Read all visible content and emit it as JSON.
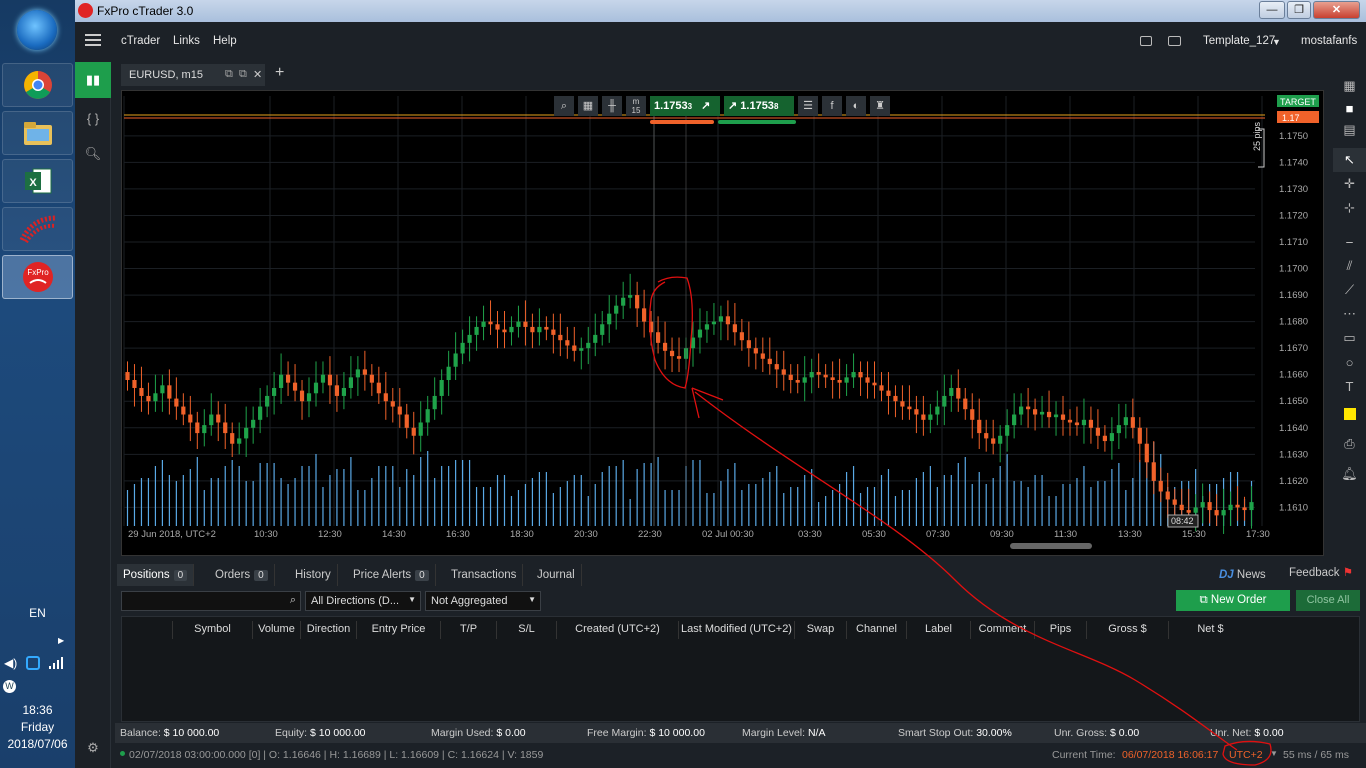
{
  "taskbar": {
    "lang": "EN",
    "time": "18:36",
    "day": "Friday",
    "date": "2018/07/06"
  },
  "window": {
    "title": "FxPro cTrader 3.0"
  },
  "menu": {
    "items": [
      "cTrader",
      "Links",
      "Help"
    ],
    "template": "Template_127",
    "user": "mostafanfs"
  },
  "tab": {
    "label": "EURUSD, m15"
  },
  "chart_toolbar": {
    "timeframe": "m",
    "timeframe_sub": "15",
    "sell_price": "1.1753",
    "sell_sup": "3",
    "buy_price": "1.1753",
    "buy_sup": "8"
  },
  "chart_data": {
    "type": "candlestick",
    "yticks": [
      "1.1750",
      "1.1740",
      "1.1730",
      "1.1720",
      "1.1710",
      "1.1700",
      "1.1690",
      "1.1680",
      "1.1670",
      "1.1660",
      "1.1650",
      "1.1640",
      "1.1630",
      "1.1620",
      "1.1610"
    ],
    "ylim": [
      1.1603,
      1.1765
    ],
    "xticks": [
      "29 Jun 2018, UTC+2",
      "10:30",
      "12:30",
      "14:30",
      "16:30",
      "18:30",
      "20:30",
      "22:30",
      "02 Jul 00:30",
      "03:30",
      "05:30",
      "07:30",
      "09:30",
      "11:30",
      "13:30",
      "15:30",
      "17:30"
    ],
    "target_label": "TARGET",
    "price_label": "1.17",
    "pips_label": "25 pips",
    "cursor_time": "08:42",
    "close": [
      1.1658,
      1.1655,
      1.1652,
      1.165,
      1.1653,
      1.1656,
      1.1651,
      1.1648,
      1.1645,
      1.1642,
      1.1638,
      1.1641,
      1.1645,
      1.1642,
      1.1638,
      1.1634,
      1.1636,
      1.164,
      1.1643,
      1.1648,
      1.1652,
      1.1655,
      1.166,
      1.1657,
      1.1654,
      1.165,
      1.1653,
      1.1657,
      1.166,
      1.1656,
      1.1652,
      1.1655,
      1.1659,
      1.1662,
      1.166,
      1.1657,
      1.1653,
      1.165,
      1.1648,
      1.1645,
      1.164,
      1.1637,
      1.1642,
      1.1647,
      1.1652,
      1.1658,
      1.1663,
      1.1668,
      1.1672,
      1.1675,
      1.1678,
      1.168,
      1.1679,
      1.1677,
      1.1676,
      1.1678,
      1.168,
      1.1678,
      1.1676,
      1.1678,
      1.1677,
      1.1675,
      1.1673,
      1.1671,
      1.1669,
      1.167,
      1.1672,
      1.1675,
      1.1679,
      1.1683,
      1.1686,
      1.1689,
      1.169,
      1.1685,
      1.168,
      1.1676,
      1.1672,
      1.1669,
      1.1667,
      1.1666,
      1.167,
      1.1674,
      1.1677,
      1.1679,
      1.168,
      1.1682,
      1.1679,
      1.1676,
      1.1673,
      1.167,
      1.1668,
      1.1666,
      1.1664,
      1.1662,
      1.166,
      1.1658,
      1.1657,
      1.1659,
      1.1661,
      1.166,
      1.1659,
      1.1658,
      1.1657,
      1.1659,
      1.1661,
      1.1659,
      1.1657,
      1.1656,
      1.1654,
      1.1652,
      1.165,
      1.1648,
      1.1647,
      1.1645,
      1.1643,
      1.1645,
      1.1648,
      1.1652,
      1.1655,
      1.1651,
      1.1647,
      1.1643,
      1.1638,
      1.1636,
      1.1634,
      1.1637,
      1.1641,
      1.1645,
      1.1648,
      1.1647,
      1.1645,
      1.1646,
      1.1644,
      1.1645,
      1.1643,
      1.1642,
      1.1641,
      1.1643,
      1.164,
      1.1637,
      1.1635,
      1.1638,
      1.1641,
      1.1644,
      1.164,
      1.1634,
      1.1627,
      1.162,
      1.1616,
      1.1613,
      1.1611,
      1.1609,
      1.1608,
      1.161,
      1.1612,
      1.1609,
      1.1607,
      1.1609,
      1.1611,
      1.161,
      1.1609,
      1.1612
    ]
  },
  "bottom": {
    "tabs": [
      {
        "label": "Positions",
        "count": "0"
      },
      {
        "label": "Orders",
        "count": "0"
      },
      {
        "label": "History"
      },
      {
        "label": "Price Alerts",
        "count": "0"
      },
      {
        "label": "Transactions"
      },
      {
        "label": "Journal"
      }
    ],
    "news": "News",
    "feedback": "Feedback",
    "filter_direction": "All Directions (D...",
    "filter_aggr": "Not Aggregated",
    "new_order": "New Order",
    "close_all": "Close All",
    "columns": [
      "Symbol",
      "Volume",
      "Direction",
      "Entry Price",
      "T/P",
      "S/L",
      "Created (UTC+2)",
      "Last Modified (UTC+2)",
      "Swap",
      "Channel",
      "Label",
      "Comment",
      "Pips",
      "Gross $",
      "Net $"
    ],
    "account": [
      {
        "k": "Balance:",
        "v": "$ 10 000.00"
      },
      {
        "k": "Equity:",
        "v": "$ 10 000.00"
      },
      {
        "k": "Margin Used:",
        "v": "$ 0.00"
      },
      {
        "k": "Free Margin:",
        "v": "$ 10 000.00"
      },
      {
        "k": "Margin Level:",
        "v": "N/A"
      },
      {
        "k": "Smart Stop Out:",
        "v": "30.00%"
      },
      {
        "k": "Unr. Gross:",
        "v": "$ 0.00"
      },
      {
        "k": "Unr. Net:",
        "v": "$ 0.00"
      }
    ],
    "status_ohlc": "02/07/2018 03:00:00.000 [0] | O: 1.16646 | H: 1.16689 | L: 1.16609 | C: 1.16624 | V: 1859",
    "current_time_label": "Current Time:",
    "current_time": "06/07/2018 16:06:17",
    "tz": "UTC+2",
    "latency": "55 ms / 65 ms"
  },
  "colors": {
    "bull": "#1fa34a",
    "bear": "#f0622a",
    "volume": "#5aa9e6",
    "accent_green": "#1e9e4c"
  }
}
